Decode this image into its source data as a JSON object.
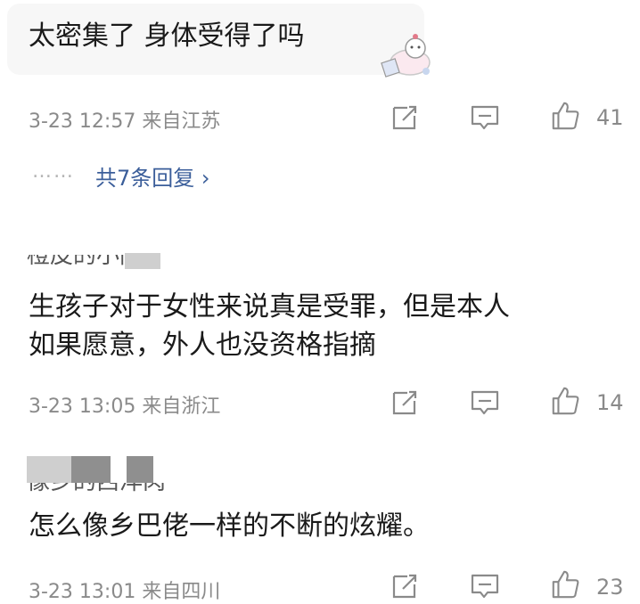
{
  "comments": [
    {
      "text_lines": [
        "太密集了 身体受得了吗"
      ],
      "meta": "3-23 12:57 来自江苏",
      "likes": "41",
      "replies": {
        "dots": "……",
        "label": "共7条回复 ›"
      }
    },
    {
      "username": "橙皮的小同",
      "text_lines": [
        "生孩子对于女性来说真是受罪，但是本人",
        "如果愿意，外人也没资格指摘"
      ],
      "meta": "3-23 13:05 来自浙江",
      "likes": "14"
    },
    {
      "username": "像乡的西洋肉",
      "text_lines": [
        "怎么像乡巴佬一样的不断的炫耀。"
      ],
      "meta": "3-23 13:01 来自四川",
      "likes": "23"
    }
  ],
  "icons": [
    "share-icon",
    "comment-icon",
    "like-icon"
  ],
  "colors": {
    "meta": "#8a8a8a",
    "link": "#3b5e9a",
    "bubble": "#f7f7f7"
  }
}
